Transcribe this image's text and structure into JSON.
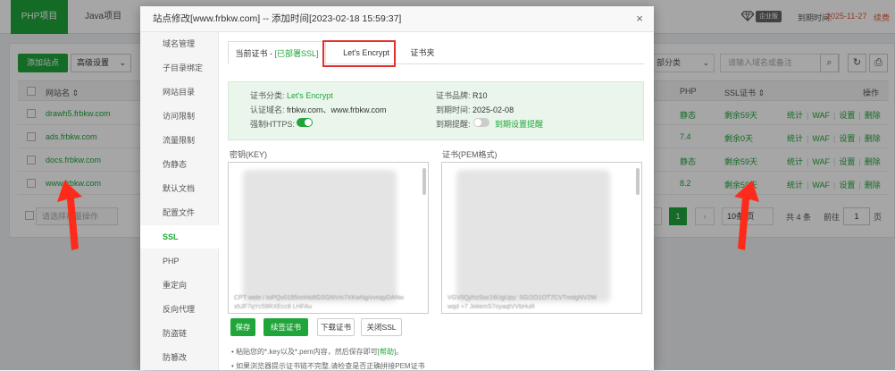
{
  "topbar": {
    "tabs": [
      "PHP项目",
      "Java项目"
    ],
    "enterprise_badge": "企业版",
    "expire_label": "到期时间:",
    "expire_date": "2025-11-27",
    "renew": "续费"
  },
  "toolbar": {
    "add_site": "添加站点",
    "advanced": "高级设置",
    "category": "部分类",
    "search_placeholder": "请输入域名或备注"
  },
  "table": {
    "headers": {
      "name": "网站名 ⇕",
      "php": "PHP",
      "ssl": "SSL证书 ⇕",
      "ops": "操作"
    },
    "rows": [
      {
        "domain": "drawh5.frbkw.com",
        "php": "静态",
        "ssl": "剩余59天",
        "ops": [
          "统计",
          "WAF",
          "设置",
          "删除"
        ]
      },
      {
        "domain": "ads.frbkw.com",
        "php": "7.4",
        "ssl": "剩余0天",
        "ops": [
          "统计",
          "WAF",
          "设置",
          "删除"
        ]
      },
      {
        "domain": "docs.frbkw.com",
        "php": "静态",
        "ssl": "剩余59天",
        "ops": [
          "统计",
          "WAF",
          "设置",
          "删除"
        ]
      },
      {
        "domain": "www.frbkw.com",
        "php": "8.2",
        "ssl": "剩余59天",
        "ops": [
          "统计",
          "WAF",
          "设置",
          "删除"
        ]
      }
    ],
    "batch_placeholder": "请选择批量操作"
  },
  "pagination": {
    "current": "1",
    "per_page": "10条/页",
    "total": "共 4 条",
    "goto_label": "前往",
    "goto_value": "1",
    "goto_unit": "页"
  },
  "modal": {
    "title": "站点修改[www.frbkw.com] -- 添加时间[2023-02-18 15:59:37]",
    "close_icon": "×",
    "sidebar": [
      "域名管理",
      "子目录绑定",
      "网站目录",
      "访问限制",
      "流量限制",
      "伪静态",
      "默认文档",
      "配置文件",
      "SSL",
      "PHP",
      "重定向",
      "反向代理",
      "防盗链",
      "防篡改"
    ],
    "tabs": {
      "current_cert": "当前证书 - ",
      "deployed": "[已部署SSL]",
      "lets_encrypt": "Let's Encrypt",
      "cert_folder": "证书夹"
    },
    "info": {
      "cat_label": "证书分类:",
      "cat_value": "Let's Encrypt",
      "brand_label": "证书品牌:",
      "brand_value": "R10",
      "domain_label": "认证域名:",
      "domain_value": "frbkw.com、www.frbkw.com",
      "expire_label": "到期时间:",
      "expire_value": "2025-02-08",
      "https_label": "强制HTTPS:",
      "remind_label": "到期提醒:",
      "remind_link": "到期设置提醒"
    },
    "key_label": "密钥(KEY)",
    "pem_label": "证书(PEM格式)",
    "key_fragment_1": "CPT wide / IoPQv0195nnHo8GSGNVm7XKwNg/vvnqyDANw",
    "key_fragment_2": "xfiJF7qYc59RXEcc8 LHFAu",
    "pem_fragment_1": "VGV0Qj/hzSoc16UgUpy: SG/2O1OT7CVTmdgNV2W",
    "pem_fragment_2": "wqd +7 JekkmS7oyaqtVVbHuR",
    "buttons": {
      "save": "保存",
      "renew": "续签证书",
      "download": "下载证书",
      "close_ssl": "关闭SSL"
    },
    "tip1_a": "粘贴您的*.key以及*.pem内容，然后保存即可",
    "tip1_b": "[帮助]",
    "tip1_c": "。",
    "tip2": "如果浏览器提示证书链不完整,请检查是否正确拼接PEM证书"
  }
}
